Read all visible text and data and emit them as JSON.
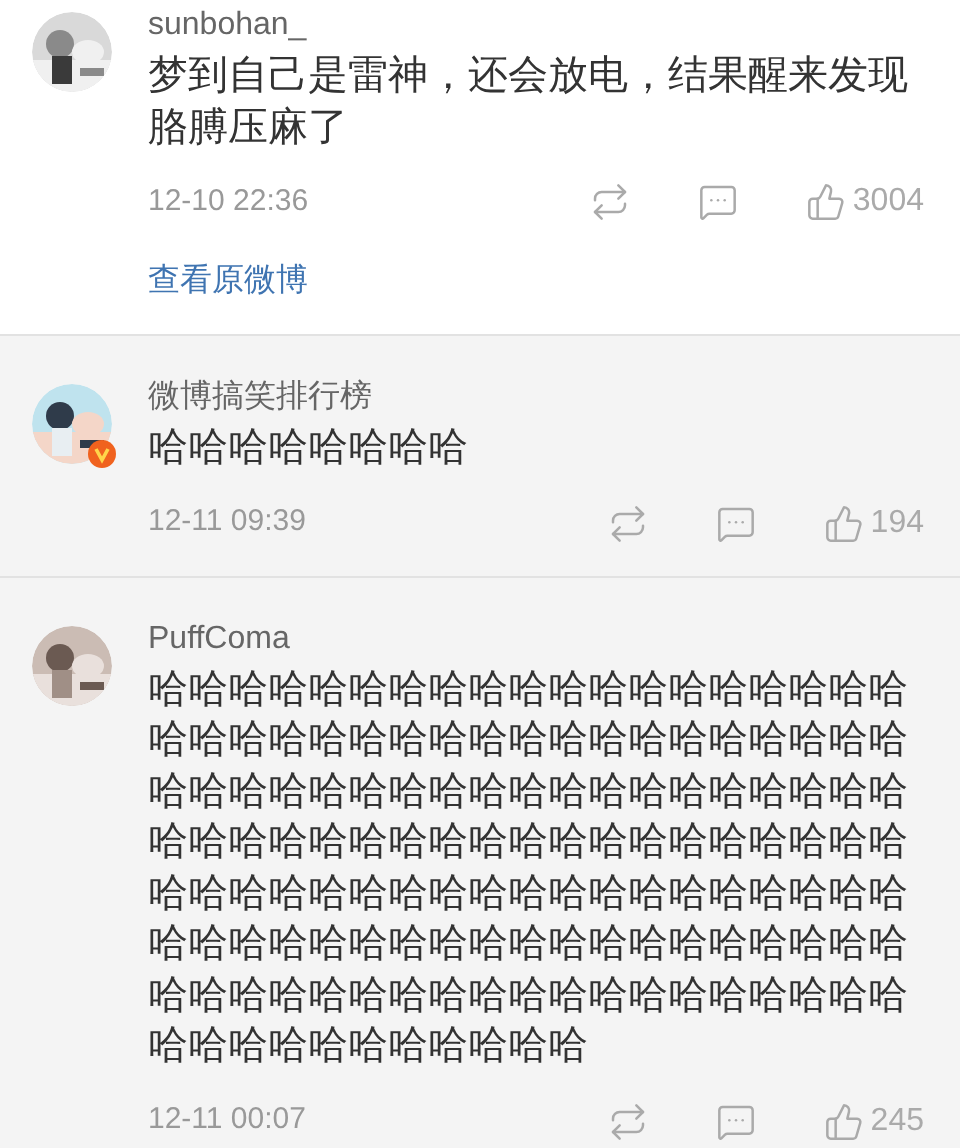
{
  "comments": [
    {
      "user": "sunbohan_",
      "verified": false,
      "highlighted": false,
      "text": "梦到自己是雷神，还会放电，结果醒来发现胳膊压麻了",
      "time": "12-10 22:36",
      "likes": "3004",
      "link": "查看原微博"
    },
    {
      "user": "微博搞笑排行榜",
      "verified": true,
      "highlighted": true,
      "text": "哈哈哈哈哈哈哈哈",
      "time": "12-11 09:39",
      "likes": "194"
    },
    {
      "user": "PuffComa",
      "verified": false,
      "highlighted": true,
      "text": "哈哈哈哈哈哈哈哈哈哈哈哈哈哈哈哈哈哈哈哈哈哈哈哈哈哈哈哈哈哈哈哈哈哈哈哈哈哈哈哈哈哈哈哈哈哈哈哈哈哈哈哈哈哈哈哈哈哈哈哈哈哈哈哈哈哈哈哈哈哈哈哈哈哈哈哈哈哈哈哈哈哈哈哈哈哈哈哈哈哈哈哈哈哈哈哈哈哈哈哈哈哈哈哈哈哈哈哈哈哈哈哈哈哈哈哈哈哈哈哈哈哈哈哈哈哈哈哈哈哈哈哈哈哈哈哈哈哈哈哈哈哈哈哈",
      "time": "12-11 00:07",
      "likes": "245"
    }
  ]
}
